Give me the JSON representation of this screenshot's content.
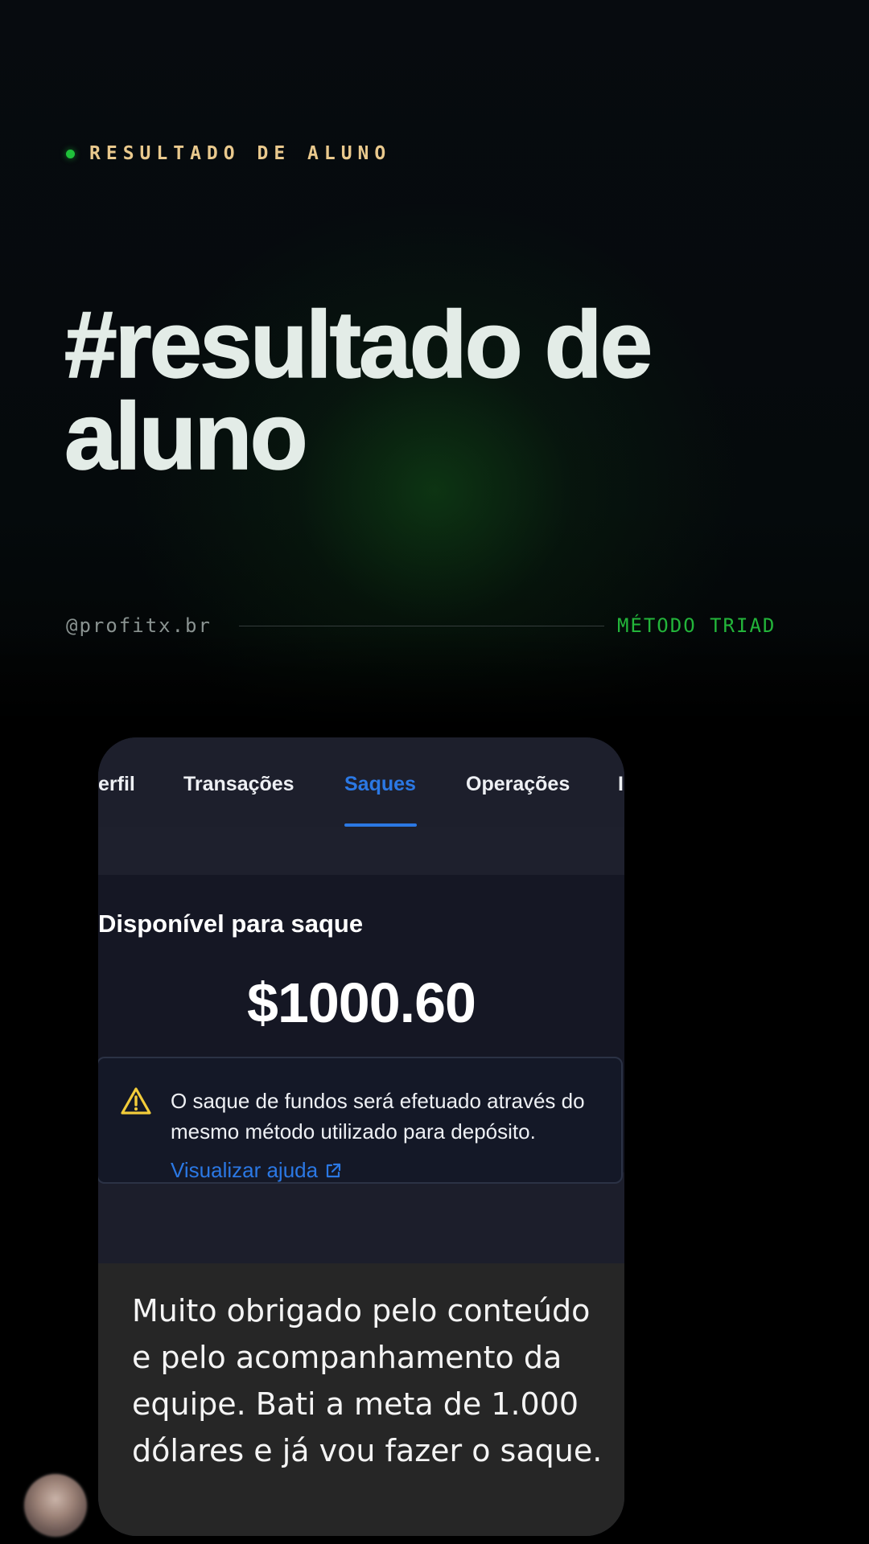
{
  "header": {
    "eyebrow": "RESULTADO DE ALUNO",
    "headline": "#resultado de aluno",
    "handle": "@profitx.br",
    "method": "MÉTODO TRIAD"
  },
  "screenshot": {
    "tabs": [
      {
        "label": "erfil"
      },
      {
        "label": "Transações"
      },
      {
        "label": "Saques",
        "active": true
      },
      {
        "label": "Operações"
      },
      {
        "label": "I"
      }
    ],
    "balance_label": "Disponível para saque",
    "balance_amount": "$1000.60",
    "notice_text": "O saque de fundos será efetuado através do mesmo método utilizado para depósito.",
    "help_link": "Visualizar ajuda"
  },
  "message": {
    "text": "Muito obrigado pelo conteúdo e pelo acompanhamento da equipe. Bati a meta de 1.000 dólares e já vou fazer o saque."
  },
  "colors": {
    "accent_green": "#1fc13a",
    "eyebrow_gold": "#e9c98d",
    "link_blue": "#2b78e4",
    "warning_yellow": "#f2cc3a"
  },
  "icons": {
    "eyebrow_dot": "status-dot-icon",
    "warning": "warning-triangle-icon",
    "external_link": "external-link-icon",
    "avatar": "blurred-avatar"
  }
}
